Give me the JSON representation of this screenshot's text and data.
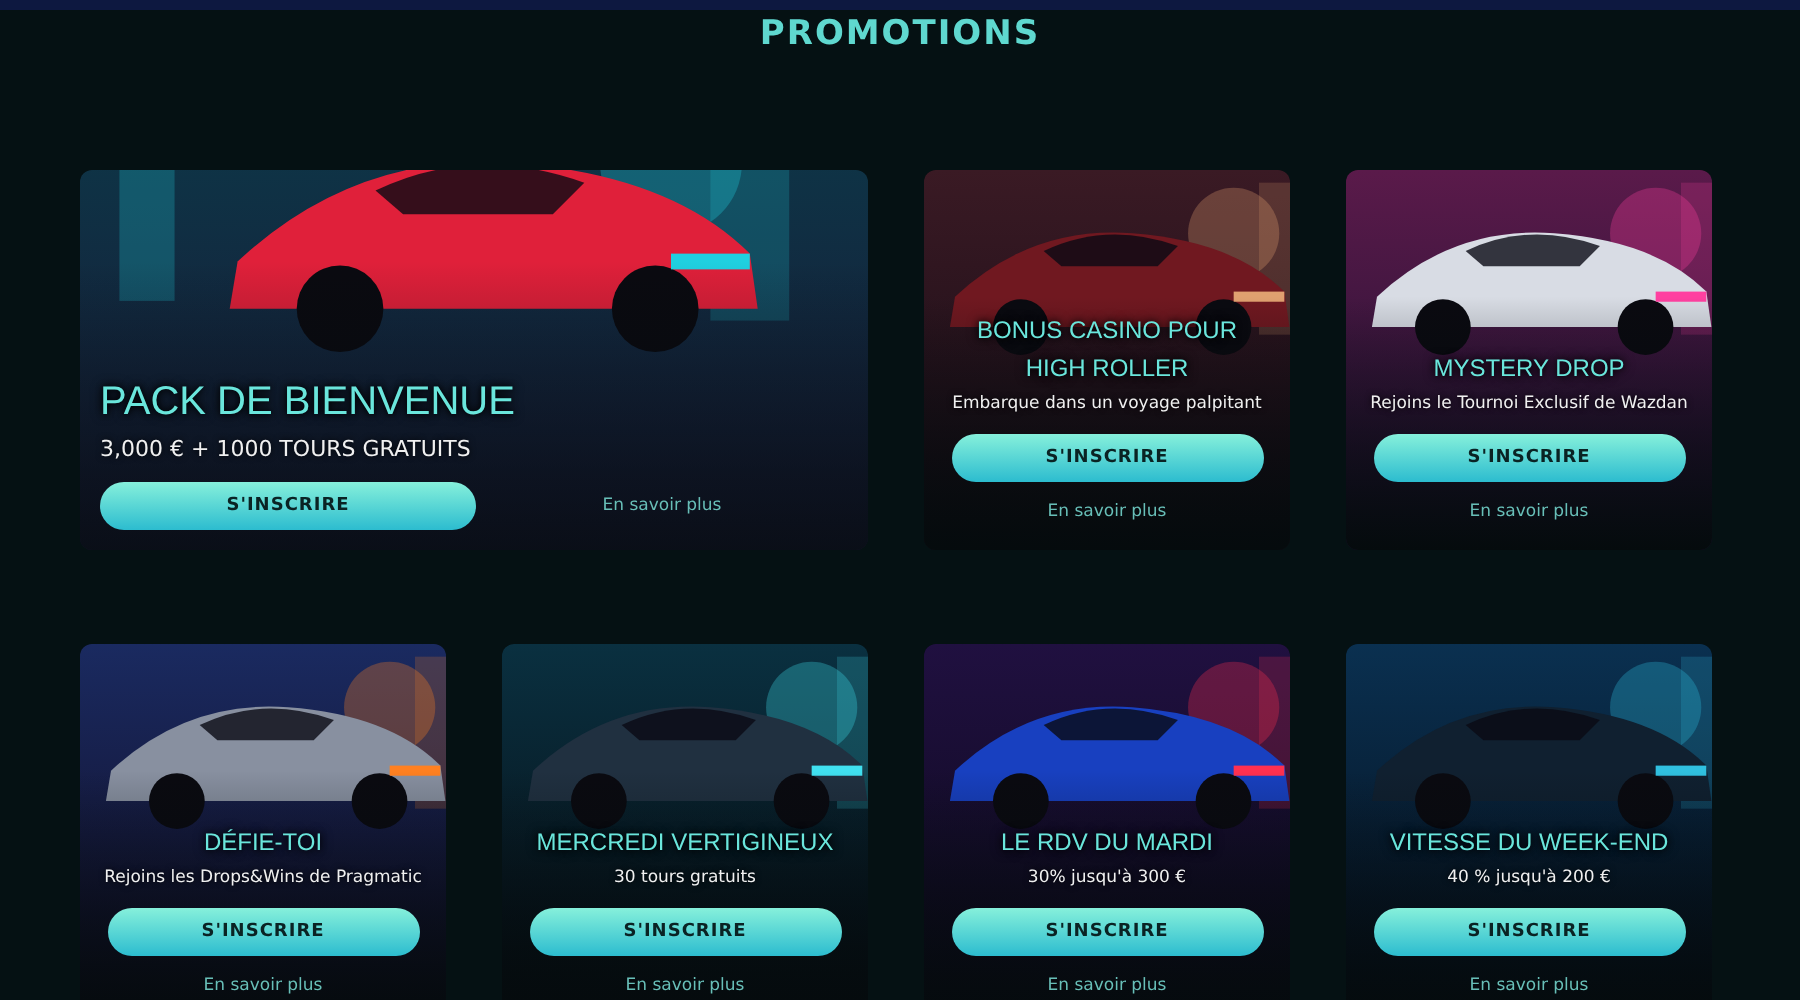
{
  "title": "PROMOTIONS",
  "promotions": [
    {
      "featured": true,
      "title": "PACK DE BIENVENUE",
      "subtitle": "3,000 € + 1000 TOURS GRATUITS",
      "button": "S'INSCRIRE",
      "link": "En savoir plus"
    },
    {
      "featured": false,
      "title": "BONUS CASINO POUR HIGH ROLLER",
      "subtitle": "Embarque dans un voyage palpitant",
      "button": "S'INSCRIRE",
      "link": "En savoir plus"
    },
    {
      "featured": false,
      "title": "MYSTERY DROP",
      "subtitle": "Rejoins le Tournoi Exclusif de Wazdan",
      "button": "S'INSCRIRE",
      "link": "En savoir plus"
    },
    {
      "featured": false,
      "title": "DÉFIE-TOI",
      "subtitle": "Rejoins les Drops&Wins de Pragmatic",
      "button": "S'INSCRIRE",
      "link": "En savoir plus"
    },
    {
      "featured": false,
      "title": "MERCREDI VERTIGINEUX",
      "subtitle": "30 tours gratuits",
      "button": "S'INSCRIRE",
      "link": "En savoir plus"
    },
    {
      "featured": false,
      "title": "LE RDV DU MARDI",
      "subtitle": "30% jusqu'à 300 €",
      "button": "S'INSCRIRE",
      "link": "En savoir plus"
    },
    {
      "featured": false,
      "title": "VITESSE DU WEEK-END",
      "subtitle": "40 % jusqu'à 200 €",
      "button": "S'INSCRIRE",
      "link": "En savoir plus"
    }
  ]
}
